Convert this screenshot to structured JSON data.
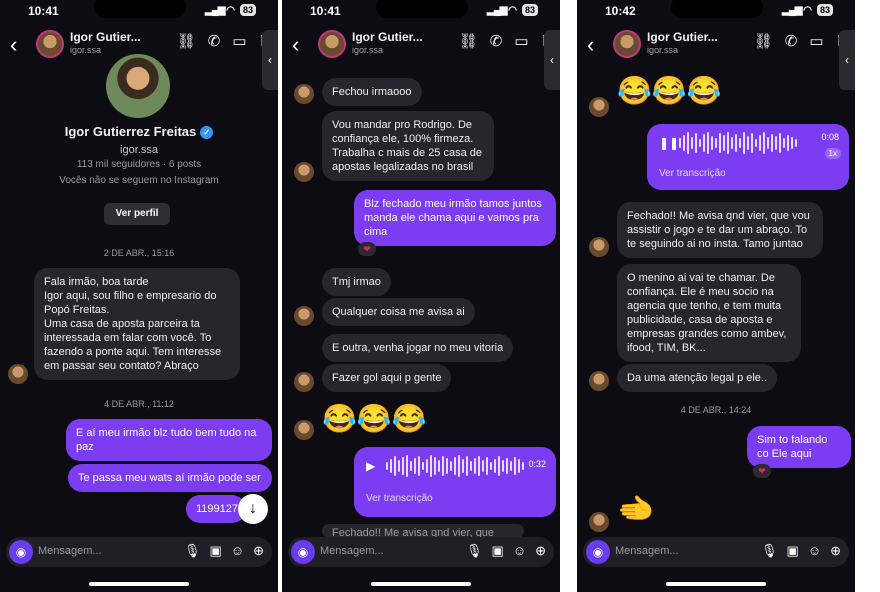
{
  "status_times": [
    "10:41",
    "10:41",
    "10:42"
  ],
  "battery": "83",
  "chat": {
    "name": "Igor Gutier...",
    "username": "igor.ssa"
  },
  "composer": {
    "placeholder": "Mensagem..."
  },
  "phone1": {
    "profile": {
      "name": "Igor Gutierrez Freitas",
      "username": "igor.ssa",
      "stats": "113 mil seguidores · 6 posts",
      "follow_status": "Vocês não se seguem no Instagram",
      "view_profile": "Ver perfil"
    },
    "stamp1": "2 DE ABR., 15:16",
    "msg1": "Fala irmão, boa tarde\nIgor aqui, sou filho e empresario do Popó Freitas.\nUma casa de aposta parceira ta interessada em falar com você. To fazendo a ponte aqui. Tem interesse em passar seu contato? Abraço",
    "stamp2": "4 DE ABR., 11:12",
    "out1": "E aí meu irmão blz tudo bem tudo na paz",
    "out2": "Te passa meu wats aí irmão pode ser",
    "out3": "1199127"
  },
  "phone2": {
    "in1": "Fechou irmaooo",
    "in2": "Vou mandar pro Rodrigo. De confiança ele, 100% firmeza. Trabalha c mais de 25 casa de apostas legalizadas no brasil",
    "out1": "Blz fechado meu irmão tamos juntos manda ele chama aqui e vamos pra cima",
    "in3": "Tmj irmao",
    "in4": "Qualquer coisa me avisa ai",
    "in5": "E outra, venha jogar no meu vitoria",
    "in6": "Fazer gol aqui p gente",
    "emojis": "😂😂😂",
    "audio": {
      "duration": "0:32",
      "transcript_label": "Ver transcrição"
    },
    "partial": "Fechado!! Me avisa qnd vier, que vou"
  },
  "phone3": {
    "emojis": "😂😂😂",
    "audio": {
      "duration": "0:08",
      "speed": "1x",
      "transcript_label": "Ver transcrição"
    },
    "in1": "Fechado!! Me avisa qnd vier, que vou assistir o jogo e te dar um abraço. To te seguindo ai no insta. Tamo juntao",
    "in2": "O menino ai vai te chamar. De confiança. Ele é meu socio na agencia que tenho, e tem muita publicidade, casa de aposta e empresas grandes como ambev, ifood, TIM, BK...",
    "in3": "Da uma atenção legal p ele..",
    "stamp": "4 DE ABR., 14:24",
    "out1": "Sim to falando co Ele aqui",
    "sticker": "🫲"
  }
}
